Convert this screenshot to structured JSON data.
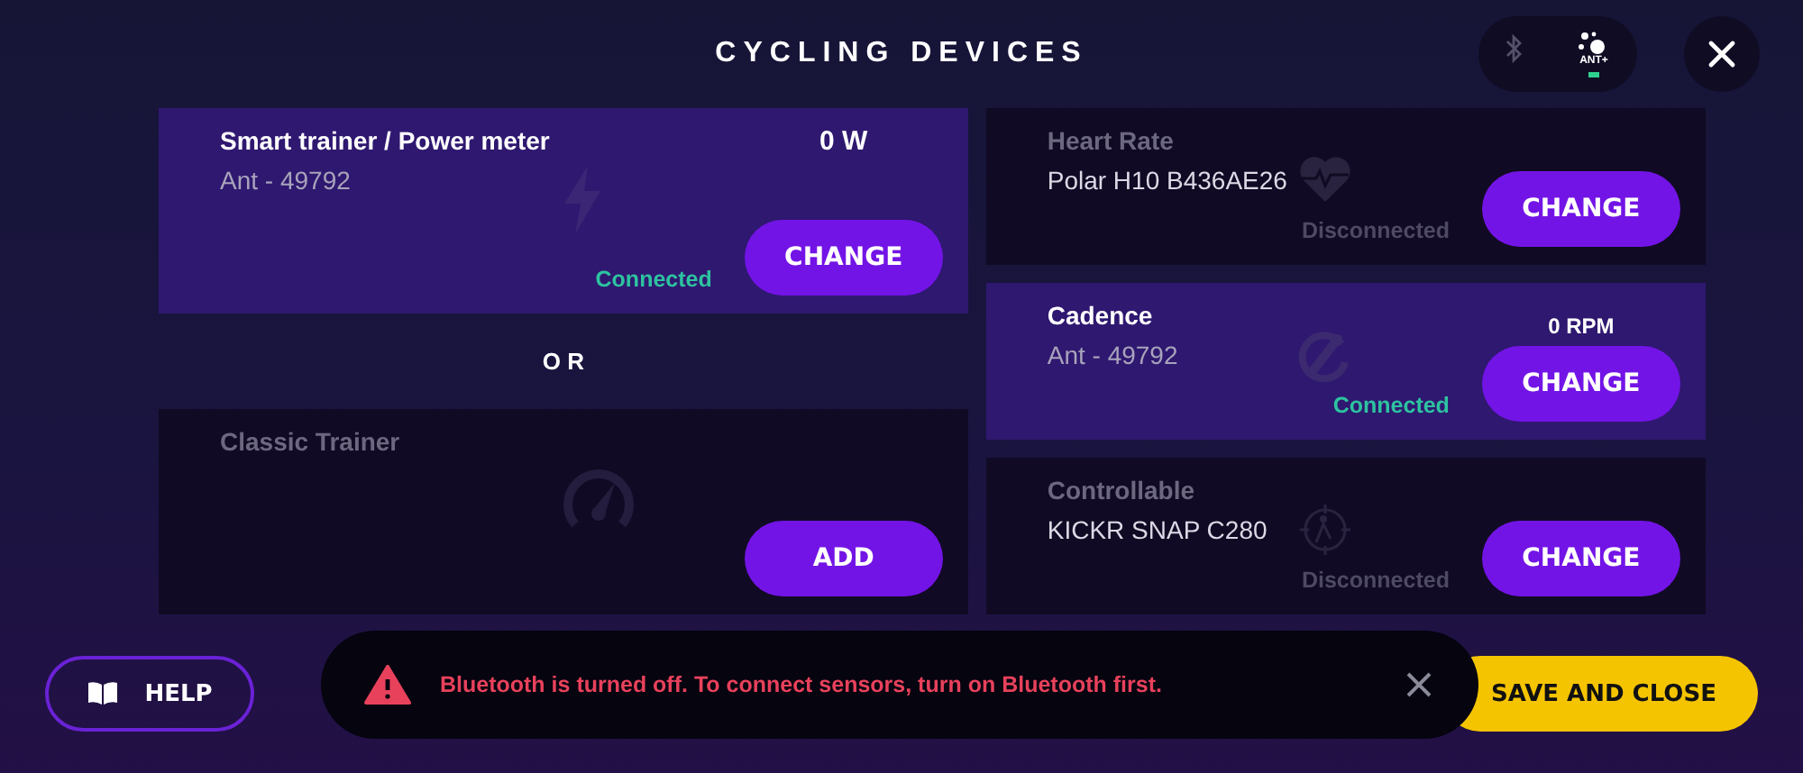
{
  "title": "CYCLING DEVICES",
  "protocols": [
    {
      "kind": "bluetooth",
      "selected": false
    },
    {
      "kind": "ant",
      "label": "ANT+",
      "selected": true
    }
  ],
  "trainers": [
    {
      "kind": "power",
      "name": "Smart trainer / Power meter",
      "device": "Ant - 49792",
      "reading": "0 W",
      "status": "Connected",
      "connected": true,
      "button": "CHANGE"
    },
    {
      "kind": "classic",
      "name": "Classic Trainer",
      "connected": false,
      "button": "ADD"
    }
  ],
  "separator": "O R",
  "sensors": [
    {
      "kind": "heart",
      "name": "Heart Rate",
      "device": "Polar H10 B436AE26",
      "status": "Disconnected",
      "connected": false,
      "button": "CHANGE"
    },
    {
      "kind": "cadence",
      "name": "Cadence",
      "device": "Ant - 49792",
      "reading": "0 RPM",
      "status": "Connected",
      "connected": true,
      "button": "CHANGE"
    },
    {
      "kind": "controllable",
      "name": "Controllable",
      "device": "KICKR SNAP C280",
      "status": "Disconnected",
      "connected": false,
      "button": "CHANGE"
    }
  ],
  "help_button": "HELP",
  "save_button": "SAVE AND CLOSE",
  "toast": {
    "message": "Bluetooth is turned off. To connect sensors, turn on Bluetooth first."
  }
}
